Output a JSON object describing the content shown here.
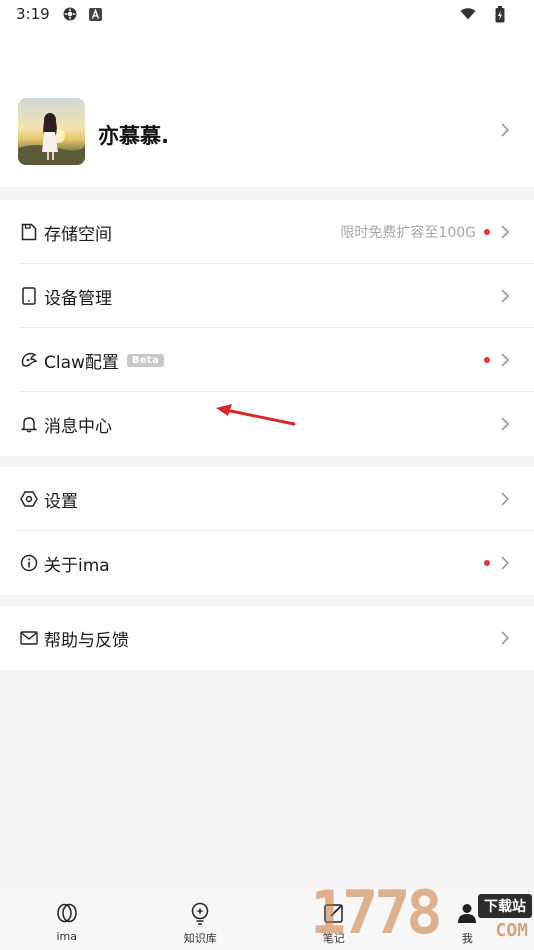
{
  "status_bar": {
    "time": "3:19",
    "icons": [
      "gear-icon",
      "a-icon",
      "wifi-icon",
      "battery-icon"
    ]
  },
  "profile": {
    "name": "亦慕慕."
  },
  "groups": [
    {
      "items": [
        {
          "id": "storage",
          "icon": "file-icon",
          "label": "存储空间",
          "hint": "限时免费扩容至100G",
          "dot": true
        },
        {
          "id": "device",
          "icon": "tablet-icon",
          "label": "设备管理"
        },
        {
          "id": "claw",
          "icon": "claw-icon",
          "label": "Claw配置",
          "badge": "Beta",
          "dot": true
        },
        {
          "id": "messages",
          "icon": "bell-icon",
          "label": "消息中心"
        }
      ]
    },
    {
      "items": [
        {
          "id": "settings",
          "icon": "hexagon-gear-icon",
          "label": "设置"
        },
        {
          "id": "about",
          "icon": "info-icon",
          "label": "关于ima",
          "dot": true
        }
      ]
    },
    {
      "items": [
        {
          "id": "help",
          "icon": "mail-icon",
          "label": "帮助与反馈"
        }
      ]
    }
  ],
  "tabbar": [
    {
      "label": "ima",
      "icon": "rings-icon"
    },
    {
      "label": "知识库",
      "icon": "bulb-icon"
    },
    {
      "label": "笔记",
      "icon": "edit-icon"
    },
    {
      "label": "我",
      "icon": "person-icon"
    }
  ],
  "watermark": {
    "text": "1778",
    "tag": "下载站",
    "com": "COM"
  },
  "colors": {
    "dot": "#e8343b",
    "annotation_arrow": "#d62828"
  }
}
